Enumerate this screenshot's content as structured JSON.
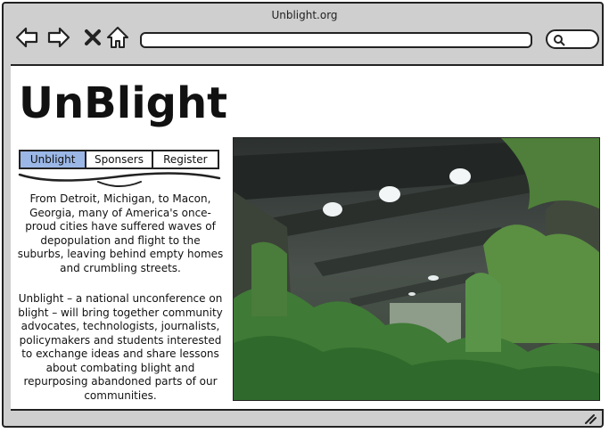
{
  "window": {
    "title": "Unblight.org"
  },
  "toolbar": {
    "back_icon": "back-arrow-icon",
    "forward_icon": "forward-arrow-icon",
    "close_icon": "close-icon",
    "home_icon": "home-icon",
    "url_value": "",
    "search_placeholder": ""
  },
  "page": {
    "site_title": "UnBlight",
    "tabs": [
      {
        "label": "Unblight",
        "active": true
      },
      {
        "label": "Sponsers",
        "active": false
      },
      {
        "label": "Register",
        "active": false
      }
    ],
    "intro_paragraph": "From Detroit, Michigan, to Macon, Georgia, many of America's once-proud cities have suffered waves of depopulation and flight to the suburbs, leaving behind empty homes and crumbling streets.",
    "about_paragraph": "Unblight – a national unconference on blight – will bring together community advocates, technologists, journalists, policymakers and students interested to exchange ideas and share lessons about combating blight and repurposing abandoned parts of our communities."
  },
  "colors": {
    "active_tab": "#9bb7e6",
    "chrome": "#cfcfcf",
    "outline": "#222222"
  }
}
